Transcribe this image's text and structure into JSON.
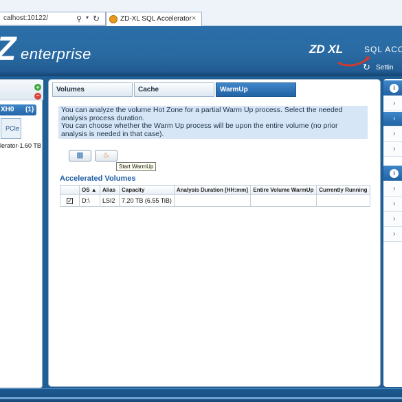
{
  "browser": {
    "address": "calhost:10122/",
    "tab_title": "ZD-XL SQL Accelerator",
    "tab_close": "×",
    "search_glyph": "⚲",
    "dropdown_glyph": "▾",
    "refresh_glyph": "↻"
  },
  "header": {
    "logo_letter": "Z",
    "logo_text": "enterprise",
    "brand": "ZD XL",
    "brand_sub": "SQL ACC",
    "settings_label": "Settin",
    "settings_glyph": "↻"
  },
  "left_panel": {
    "add_glyph": "+",
    "remove_glyph": "−",
    "device_name": "XH0",
    "device_count": "(1)",
    "card_label": "PCIe",
    "accelerator_label": "elerator-1.60 TB"
  },
  "tabs": [
    {
      "label": "Volumes",
      "active": false
    },
    {
      "label": "Cache",
      "active": false
    },
    {
      "label": "WarmUp",
      "active": true
    }
  ],
  "info": {
    "line1": "You can analyze the volume Hot Zone for a partial Warm Up process. Select the needed analysis process duration.",
    "line2": "You can choose whether the Warm Up process will be upon the entire volume (no prior analysis is needed in that case)."
  },
  "actions": {
    "analyze_glyph": "▦",
    "warmup_glyph": "♨",
    "tooltip": "Start WarmUp"
  },
  "section_title": "Accelerated Volumes",
  "table": {
    "columns": [
      "",
      "OS ▲",
      "Alias",
      "Capacity",
      "Analysis Duration [HH:mm]",
      "Entire Volume WarmUp",
      "Currently Running"
    ],
    "rows": [
      {
        "checked": "✓",
        "os": "D:\\",
        "alias": "LSI2",
        "capacity": "7.20 TB (6.55 TiB)",
        "duration": "",
        "entire": "",
        "running": ""
      }
    ]
  },
  "right_panel": {
    "chevron": "›",
    "icon1": "i",
    "icon2": "i"
  },
  "colors": {
    "accent": "#2163a4",
    "header_bg": "#2b6ea8",
    "info_bg": "#d6e6f7",
    "brand_red": "#d33a2c"
  }
}
